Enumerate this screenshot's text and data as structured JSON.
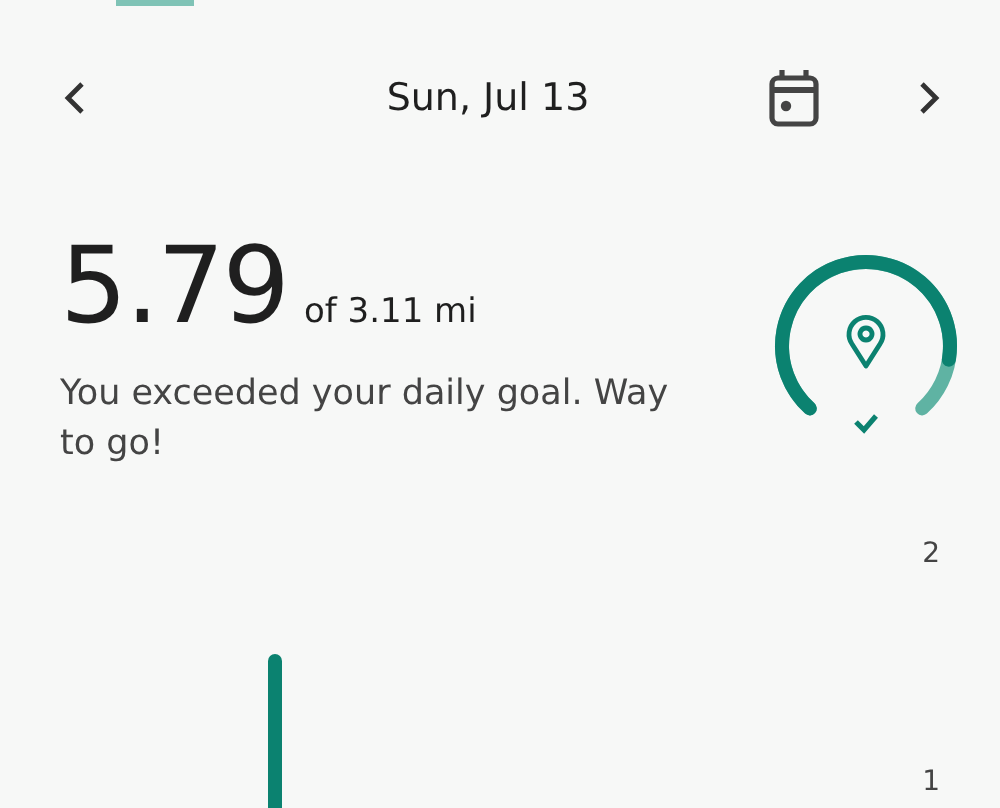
{
  "header": {
    "date": "Sun, Jul 13"
  },
  "summary": {
    "value": "5.79",
    "goal": "of 3.11 mi",
    "message": "You exceeded your daily goal. Way to go!"
  },
  "chart": {
    "axis_labels": [
      "2",
      "1"
    ]
  }
}
